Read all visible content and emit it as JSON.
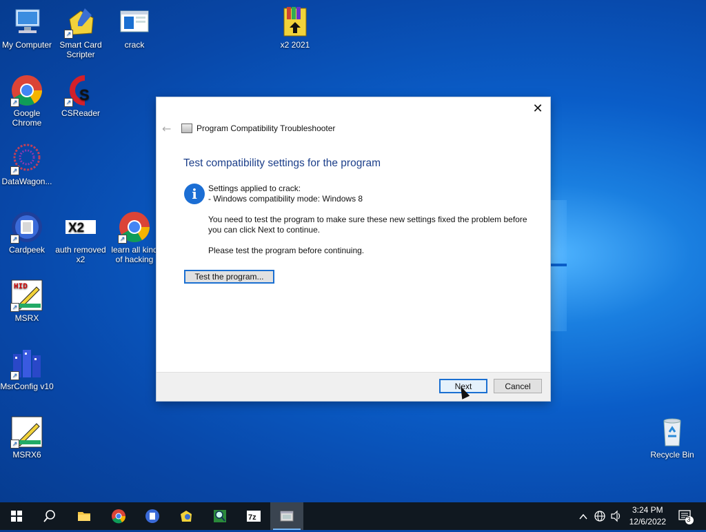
{
  "desktop": {
    "icons": [
      {
        "label": "My Computer"
      },
      {
        "label": "Smart Card Scripter"
      },
      {
        "label": "crack"
      },
      {
        "label": "x2 2021"
      },
      {
        "label": "Google Chrome"
      },
      {
        "label": "CSReader"
      },
      {
        "label": "DataWagon..."
      },
      {
        "label": "Cardpeek"
      },
      {
        "label": "auth removed x2"
      },
      {
        "label": "learn all kind of hacking"
      },
      {
        "label": "MSRX"
      },
      {
        "label": "MsrConfig v10"
      },
      {
        "label": "MSRX6"
      },
      {
        "label": "Recycle Bin"
      }
    ]
  },
  "dialog": {
    "title": "Program Compatibility Troubleshooter",
    "close_glyph": "✕",
    "back_glyph": "←",
    "heading": "Test compatibility settings for the program",
    "settings_applied": "Settings applied to crack:",
    "compat_mode": "- Windows compatibility mode: Windows 8",
    "instruction": "You need to test the program to make sure these new settings fixed the problem before you can click Next to continue.",
    "please_test": "Please test the program before continuing.",
    "test_button": "Test the program...",
    "next_button": "Next",
    "cancel_button": "Cancel"
  },
  "taskbar": {
    "time": "3:24 PM",
    "date": "12/6/2022",
    "notification_count": "3",
    "pinned": [
      "start",
      "search",
      "file-explorer",
      "chrome",
      "cardpeek",
      "smart-card-scripter",
      "search-tool",
      "7zip",
      "troubleshooter"
    ],
    "label_7z": "7z"
  },
  "colors": {
    "heading": "#1c3f8a",
    "accent": "#1a6fd1",
    "taskbar": "#101820"
  }
}
